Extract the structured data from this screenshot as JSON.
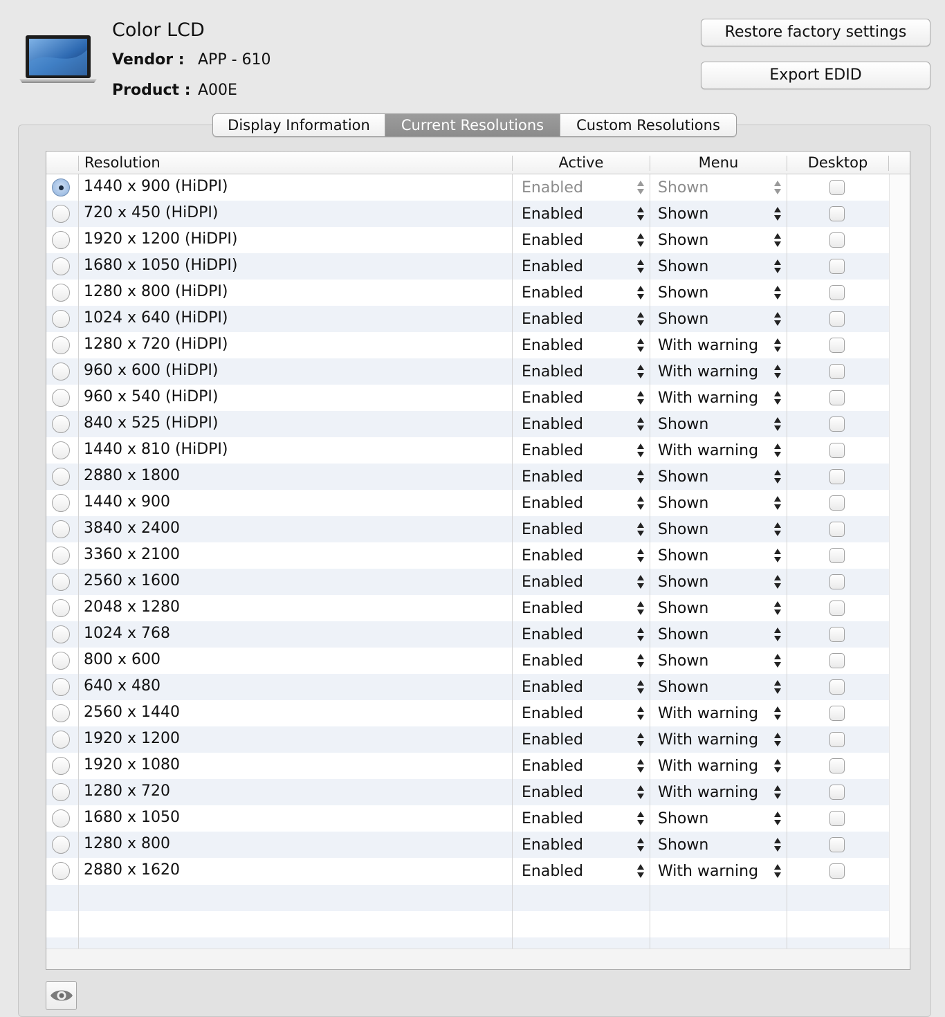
{
  "header": {
    "display_name": "Color LCD",
    "vendor_label": "Vendor :",
    "vendor_value": "APP - 610",
    "product_label": "Product :",
    "product_value": "A00E",
    "laptop_icon": "laptop-icon"
  },
  "buttons": {
    "restore": "Restore factory settings",
    "export": "Export EDID"
  },
  "tabs": [
    {
      "label": "Display Information",
      "active": false
    },
    {
      "label": "Current Resolutions",
      "active": true
    },
    {
      "label": "Custom Resolutions",
      "active": false
    }
  ],
  "table": {
    "columns": {
      "resolution": "Resolution",
      "active": "Active",
      "menu": "Menu",
      "desktop": "Desktop"
    },
    "rows": [
      {
        "resolution": "1440 x 900 (HiDPI)",
        "active": "Enabled",
        "menu": "Shown",
        "selected": true,
        "dimmed": true,
        "desktop": false
      },
      {
        "resolution": "720 x 450 (HiDPI)",
        "active": "Enabled",
        "menu": "Shown",
        "selected": false,
        "dimmed": false,
        "desktop": false
      },
      {
        "resolution": "1920 x 1200 (HiDPI)",
        "active": "Enabled",
        "menu": "Shown",
        "selected": false,
        "dimmed": false,
        "desktop": false
      },
      {
        "resolution": "1680 x 1050 (HiDPI)",
        "active": "Enabled",
        "menu": "Shown",
        "selected": false,
        "dimmed": false,
        "desktop": false
      },
      {
        "resolution": "1280 x 800 (HiDPI)",
        "active": "Enabled",
        "menu": "Shown",
        "selected": false,
        "dimmed": false,
        "desktop": false
      },
      {
        "resolution": "1024 x 640 (HiDPI)",
        "active": "Enabled",
        "menu": "Shown",
        "selected": false,
        "dimmed": false,
        "desktop": false
      },
      {
        "resolution": "1280 x 720 (HiDPI)",
        "active": "Enabled",
        "menu": "With warning",
        "selected": false,
        "dimmed": false,
        "desktop": false
      },
      {
        "resolution": "960 x 600 (HiDPI)",
        "active": "Enabled",
        "menu": "With warning",
        "selected": false,
        "dimmed": false,
        "desktop": false
      },
      {
        "resolution": "960 x 540 (HiDPI)",
        "active": "Enabled",
        "menu": "With warning",
        "selected": false,
        "dimmed": false,
        "desktop": false
      },
      {
        "resolution": "840 x 525 (HiDPI)",
        "active": "Enabled",
        "menu": "Shown",
        "selected": false,
        "dimmed": false,
        "desktop": false
      },
      {
        "resolution": "1440 x 810 (HiDPI)",
        "active": "Enabled",
        "menu": "With warning",
        "selected": false,
        "dimmed": false,
        "desktop": false
      },
      {
        "resolution": "2880 x 1800",
        "active": "Enabled",
        "menu": "Shown",
        "selected": false,
        "dimmed": false,
        "desktop": false
      },
      {
        "resolution": "1440 x 900",
        "active": "Enabled",
        "menu": "Shown",
        "selected": false,
        "dimmed": false,
        "desktop": false
      },
      {
        "resolution": "3840 x 2400",
        "active": "Enabled",
        "menu": "Shown",
        "selected": false,
        "dimmed": false,
        "desktop": false
      },
      {
        "resolution": "3360 x 2100",
        "active": "Enabled",
        "menu": "Shown",
        "selected": false,
        "dimmed": false,
        "desktop": false
      },
      {
        "resolution": "2560 x 1600",
        "active": "Enabled",
        "menu": "Shown",
        "selected": false,
        "dimmed": false,
        "desktop": false
      },
      {
        "resolution": "2048 x 1280",
        "active": "Enabled",
        "menu": "Shown",
        "selected": false,
        "dimmed": false,
        "desktop": false
      },
      {
        "resolution": "1024 x 768",
        "active": "Enabled",
        "menu": "Shown",
        "selected": false,
        "dimmed": false,
        "desktop": false
      },
      {
        "resolution": "800 x 600",
        "active": "Enabled",
        "menu": "Shown",
        "selected": false,
        "dimmed": false,
        "desktop": false
      },
      {
        "resolution": "640 x 480",
        "active": "Enabled",
        "menu": "Shown",
        "selected": false,
        "dimmed": false,
        "desktop": false
      },
      {
        "resolution": "2560 x 1440",
        "active": "Enabled",
        "menu": "With warning",
        "selected": false,
        "dimmed": false,
        "desktop": false
      },
      {
        "resolution": "1920 x 1200",
        "active": "Enabled",
        "menu": "With warning",
        "selected": false,
        "dimmed": false,
        "desktop": false
      },
      {
        "resolution": "1920 x 1080",
        "active": "Enabled",
        "menu": "With warning",
        "selected": false,
        "dimmed": false,
        "desktop": false
      },
      {
        "resolution": "1280 x 720",
        "active": "Enabled",
        "menu": "With warning",
        "selected": false,
        "dimmed": false,
        "desktop": false
      },
      {
        "resolution": "1680 x 1050",
        "active": "Enabled",
        "menu": "Shown",
        "selected": false,
        "dimmed": false,
        "desktop": false
      },
      {
        "resolution": "1280 x 800",
        "active": "Enabled",
        "menu": "Shown",
        "selected": false,
        "dimmed": false,
        "desktop": false
      },
      {
        "resolution": "2880 x 1620",
        "active": "Enabled",
        "menu": "With warning",
        "selected": false,
        "dimmed": false,
        "desktop": false
      }
    ]
  },
  "footer": {
    "eye_icon": "eye-icon"
  },
  "colors": {
    "window_bg": "#e8e8e8",
    "row_alt": "#eef2f8",
    "tab_active": "#8f8f8f",
    "radio_selected": "#a7c3e6",
    "dimmed_text": "#8c8c8c"
  }
}
